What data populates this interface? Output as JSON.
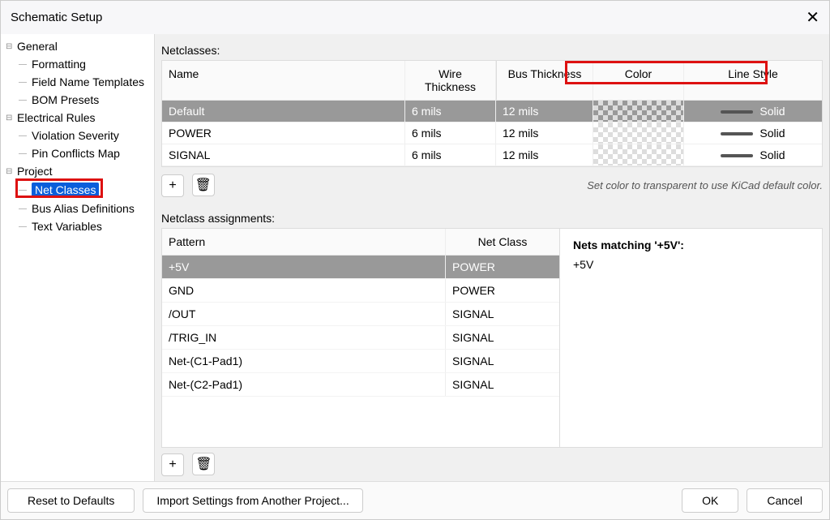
{
  "title": "Schematic Setup",
  "tree": {
    "general": {
      "label": "General",
      "children": [
        "Formatting",
        "Field Name Templates",
        "BOM Presets"
      ]
    },
    "electrical": {
      "label": "Electrical Rules",
      "children": [
        "Violation Severity",
        "Pin Conflicts Map"
      ]
    },
    "project": {
      "label": "Project",
      "children": [
        "Net Classes",
        "Bus Alias Definitions",
        "Text Variables"
      ]
    }
  },
  "netclasses_label": "Netclasses:",
  "nc_headers": {
    "name": "Name",
    "wt": "Wire Thickness",
    "bt": "Bus Thickness",
    "color": "Color",
    "ls": "Line Style"
  },
  "nc_rows": [
    {
      "name": "Default",
      "wt": "6 mils",
      "bt": "12 mils",
      "ls": "Solid",
      "selected": true
    },
    {
      "name": "POWER",
      "wt": "6 mils",
      "bt": "12 mils",
      "ls": "Solid",
      "selected": false
    },
    {
      "name": "SIGNAL",
      "wt": "6 mils",
      "bt": "12 mils",
      "ls": "Solid",
      "selected": false
    }
  ],
  "hint": "Set color to transparent to use KiCad default color.",
  "assign_label": "Netclass assignments:",
  "assign_headers": {
    "pattern": "Pattern",
    "netclass": "Net Class"
  },
  "assign_rows": [
    {
      "pattern": "+5V",
      "netclass": "POWER",
      "selected": true
    },
    {
      "pattern": "GND",
      "netclass": "POWER",
      "selected": false
    },
    {
      "pattern": "/OUT",
      "netclass": "SIGNAL",
      "selected": false
    },
    {
      "pattern": "/TRIG_IN",
      "netclass": "SIGNAL",
      "selected": false
    },
    {
      "pattern": "Net-(C1-Pad1)",
      "netclass": "SIGNAL",
      "selected": false
    },
    {
      "pattern": "Net-(C2-Pad1)",
      "netclass": "SIGNAL",
      "selected": false
    }
  ],
  "match": {
    "title": "Nets matching '+5V':",
    "items": [
      "+5V"
    ]
  },
  "buttons": {
    "plus": "+",
    "trash": "🗑",
    "reset": "Reset to Defaults",
    "import": "Import Settings from Another Project...",
    "ok": "OK",
    "cancel": "Cancel"
  }
}
